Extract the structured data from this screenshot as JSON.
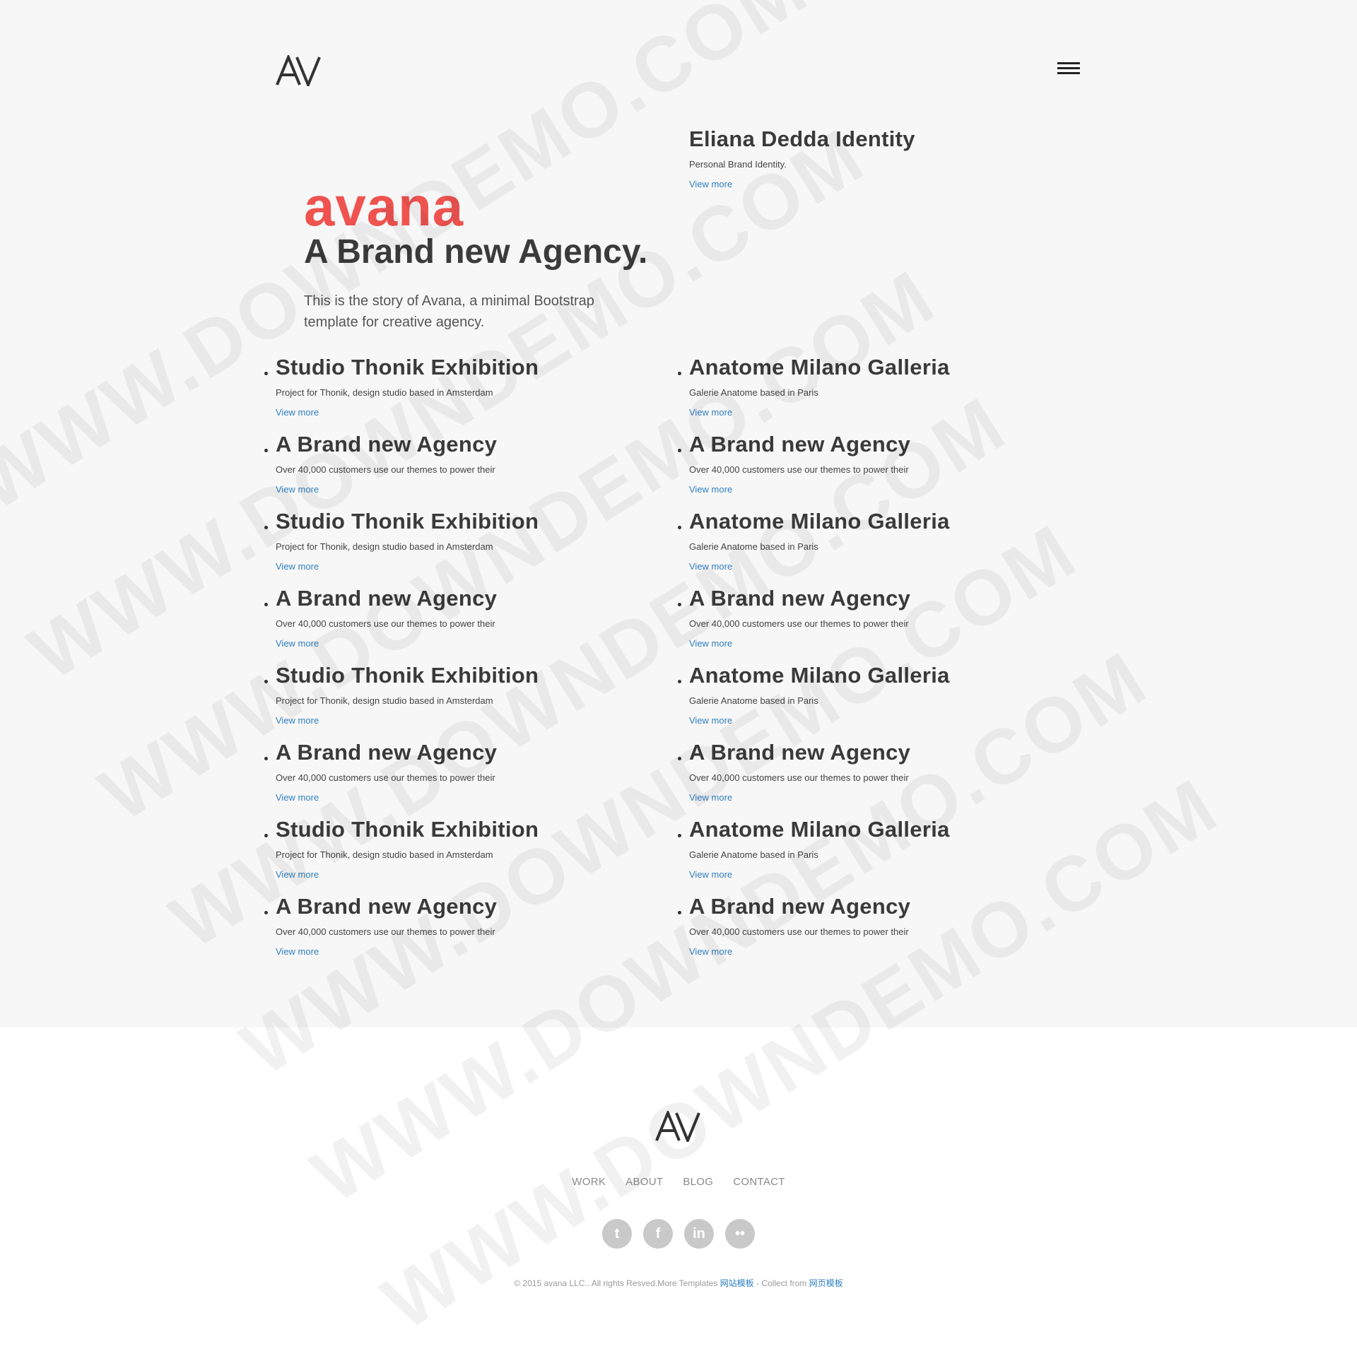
{
  "header": {
    "logo_text": "AV",
    "menu_icon": "hamburger-icon"
  },
  "featured": {
    "title": "Eliana Dedda Identity",
    "description": "Personal Brand Identity.",
    "link": "View more"
  },
  "hero": {
    "brand": "avana",
    "tagline": "A Brand new Agency.",
    "description": "This is the story of Avana, a minimal Bootstrap template for creative agency."
  },
  "projects": {
    "left": [
      {
        "title": "Studio Thonik Exhibition",
        "description": "Project for Thonik, design studio based in Amsterdam",
        "link": "View more"
      },
      {
        "title": "A Brand new Agency",
        "description": "Over 40,000 customers use our themes to power their",
        "link": "View more"
      },
      {
        "title": "Studio Thonik Exhibition",
        "description": "Project for Thonik, design studio based in Amsterdam",
        "link": "View more"
      },
      {
        "title": "A Brand new Agency",
        "description": "Over 40,000 customers use our themes to power their",
        "link": "View more"
      },
      {
        "title": "Studio Thonik Exhibition",
        "description": "Project for Thonik, design studio based in Amsterdam",
        "link": "View more"
      },
      {
        "title": "A Brand new Agency",
        "description": "Over 40,000 customers use our themes to power their",
        "link": "View more"
      },
      {
        "title": "Studio Thonik Exhibition",
        "description": "Project for Thonik, design studio based in Amsterdam",
        "link": "View more"
      },
      {
        "title": "A Brand new Agency",
        "description": "Over 40,000 customers use our themes to power their",
        "link": "View more"
      }
    ],
    "right": [
      {
        "title": "Anatome Milano Galleria",
        "description": "Galerie Anatome based in Paris",
        "link": "View more"
      },
      {
        "title": "A Brand new Agency",
        "description": "Over 40,000 customers use our themes to power their",
        "link": "View more"
      },
      {
        "title": "Anatome Milano Galleria",
        "description": "Galerie Anatome based in Paris",
        "link": "View more"
      },
      {
        "title": "A Brand new Agency",
        "description": "Over 40,000 customers use our themes to power their",
        "link": "View more"
      },
      {
        "title": "Anatome Milano Galleria",
        "description": "Galerie Anatome based in Paris",
        "link": "View more"
      },
      {
        "title": "A Brand new Agency",
        "description": "Over 40,000 customers use our themes to power their",
        "link": "View more"
      },
      {
        "title": "Anatome Milano Galleria",
        "description": "Galerie Anatome based in Paris",
        "link": "View more"
      },
      {
        "title": "A Brand new Agency",
        "description": "Over 40,000 customers use our themes to power their",
        "link": "View more"
      }
    ]
  },
  "footer": {
    "logo_text": "AV",
    "nav": [
      "WORK",
      "ABOUT",
      "BLOG",
      "CONTACT"
    ],
    "social": [
      {
        "icon": "twitter-icon",
        "glyph": "t"
      },
      {
        "icon": "facebook-icon",
        "glyph": "f"
      },
      {
        "icon": "linkedin-icon",
        "glyph": "in"
      },
      {
        "icon": "flickr-icon",
        "glyph": "••"
      }
    ],
    "copyright_prefix": "© 2015 avana LLC.. All rights Resved.More Templates ",
    "link1": "网站模板",
    "copyright_middle": " - Collect from ",
    "link2": "网页模板"
  },
  "watermark": {
    "text": "WWW.DOWNDEMO.COM"
  },
  "colors": {
    "brand_red": "#ef5350",
    "link_blue": "#2f7fc1",
    "background": "#f7f7f7",
    "footer_background": "#ffffff",
    "social_circle": "#c9c9c9"
  }
}
